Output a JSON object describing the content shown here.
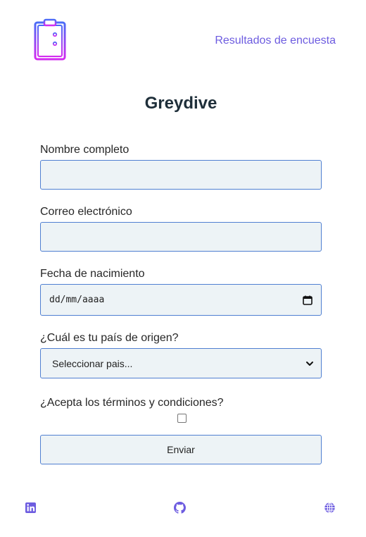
{
  "header": {
    "logo_icon": "clipboard-list-icon",
    "nav_link": "Resultados de encuesta"
  },
  "title": "Greydive",
  "form": {
    "name": {
      "label": "Nombre completo",
      "value": ""
    },
    "email": {
      "label": "Correo electrónico",
      "value": ""
    },
    "birthdate": {
      "label": "Fecha de nacimiento",
      "placeholder": "dd/mm/aaaa"
    },
    "country": {
      "label": "¿Cuál es tu país de origen?",
      "selected": "Seleccionar pais..."
    },
    "terms": {
      "label": "¿Acepta los términos y condiciones?",
      "checked": false
    },
    "submit_label": "Enviar"
  },
  "footer": {
    "icons": [
      "linkedin-icon",
      "github-icon",
      "globe-icon"
    ]
  },
  "colors": {
    "accent": "#6d5ce0",
    "title": "#1f2f3a",
    "field_bg": "#edf3f6",
    "field_border": "#4f7fd1",
    "logo_gradient_start": "#4a6cf7",
    "logo_gradient_end": "#d42bf0"
  }
}
